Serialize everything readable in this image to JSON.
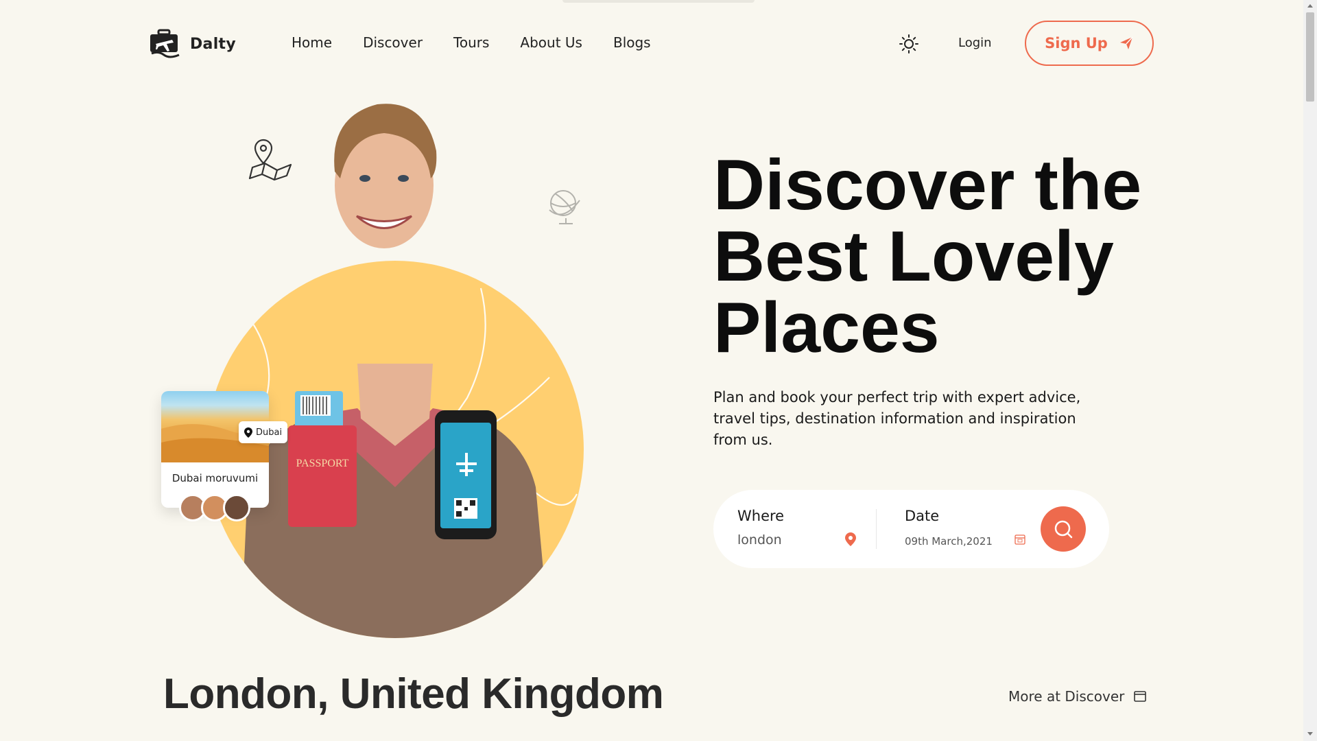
{
  "brand": {
    "name": "Dalty"
  },
  "nav": [
    {
      "label": "Home"
    },
    {
      "label": "Discover"
    },
    {
      "label": "Tours"
    },
    {
      "label": "About Us"
    },
    {
      "label": "Blogs"
    }
  ],
  "header": {
    "login_label": "Login",
    "signup_label": "Sign Up",
    "theme_icon": "sun-icon"
  },
  "hero": {
    "title_lines": [
      "Discover the",
      "Best Lovely",
      "Places"
    ],
    "subtitle": "Plan and book your perfect trip with expert advice, travel tips, destination information and inspiration from us."
  },
  "dubai_card": {
    "tag": "Dubai",
    "title": "Dubai moruvumi"
  },
  "search": {
    "where_label": "Where",
    "where_value": "london",
    "date_label": "Date",
    "date_value": "09th March,2021"
  },
  "section": {
    "title": "London, United Kingdom",
    "more_label": "More at Discover"
  },
  "colors": {
    "accent": "#ee6a4d",
    "circle": "#ffcf70",
    "background": "#f9f7ef"
  }
}
